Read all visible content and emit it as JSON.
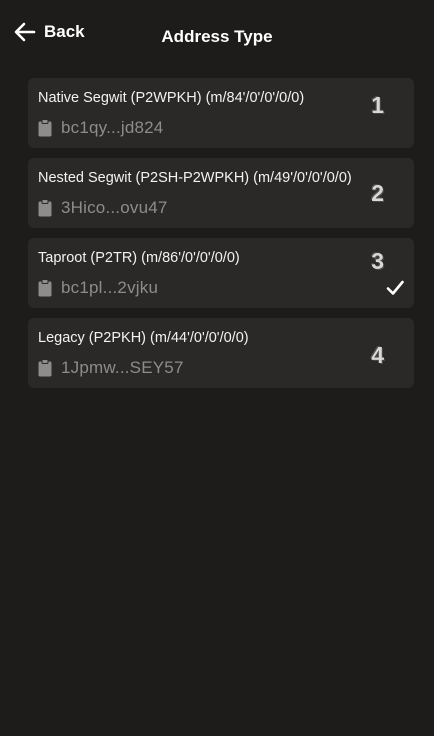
{
  "header": {
    "back_label": "Back",
    "title": "Address Type"
  },
  "address_types": [
    {
      "title": "Native Segwit (P2WPKH) (m/84'/0'/0'/0/0)",
      "address": "bc1qy...jd824",
      "number": "1",
      "selected": false
    },
    {
      "title": "Nested Segwit (P2SH-P2WPKH) (m/49'/0'/0'/0/0)",
      "address": "3Hico...ovu47",
      "number": "2",
      "selected": false
    },
    {
      "title": "Taproot (P2TR) (m/86'/0'/0'/0/0)",
      "address": "bc1pl...2vjku",
      "number": "3",
      "selected": true
    },
    {
      "title": "Legacy (P2PKH) (m/44'/0'/0'/0/0)",
      "address": "1Jpmw...SEY57",
      "number": "4",
      "selected": false
    }
  ],
  "icons": {
    "back": "arrow-left-icon",
    "address": "clipboard-icon",
    "selected": "checkmark-icon"
  },
  "colors": {
    "background": "#1e1c1b",
    "card": "#2b2928",
    "address_text": "#8e8c8b"
  }
}
